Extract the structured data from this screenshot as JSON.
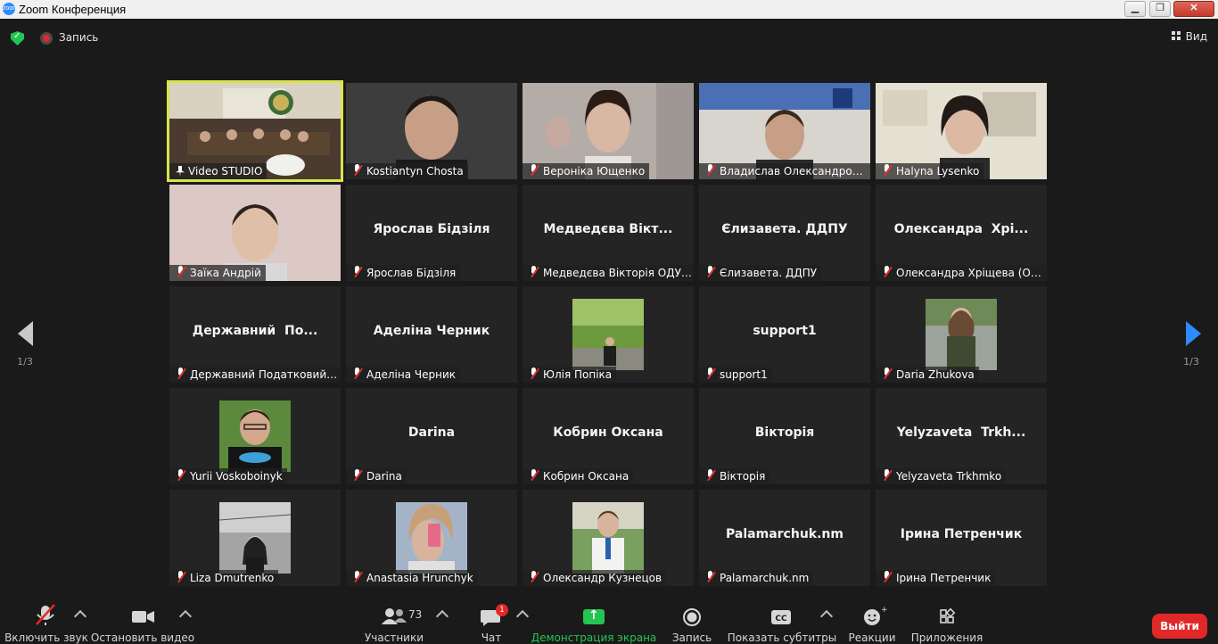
{
  "window": {
    "title": "Zoom Конференция",
    "app_icon": "zoom",
    "buttons": [
      "minimize",
      "maximize",
      "close"
    ]
  },
  "topbar": {
    "recording_label": "Запись",
    "view_label": "Вид"
  },
  "pagination": {
    "left": "1/3",
    "right": "1/3"
  },
  "tiles": [
    {
      "label": "Video STUDIO",
      "display": "",
      "video": "room",
      "icon": "pin-icon",
      "active": true
    },
    {
      "label": "Kostiantyn Chosta",
      "display": "",
      "video": "person-dark",
      "icon": "mute-icon"
    },
    {
      "label": "Вероніка Ющенко",
      "display": "",
      "video": "person-light",
      "icon": "mute-icon"
    },
    {
      "label": "Владислав Олександрови...",
      "display": "",
      "video": "person-blue",
      "icon": "mute-icon"
    },
    {
      "label": "Halyna Lysenko",
      "display": "",
      "video": "person-wall",
      "icon": "mute-icon"
    },
    {
      "label": "Заїка Андрій",
      "display": "",
      "video": "person-pink",
      "icon": "mute-icon"
    },
    {
      "label": "Ярослав Бідзіля",
      "display": "Ярослав Бідзіля",
      "icon": "mute-icon"
    },
    {
      "label": "Медведєва Вікторія ОДУВС",
      "display": "Медведєва Вікт...",
      "icon": "mute-icon"
    },
    {
      "label": "Єлизавета. ДДПУ",
      "display": "Єлизавета. ДДПУ",
      "icon": "mute-icon"
    },
    {
      "label": "Олександра Хріщева (ОНУ)",
      "display": "Олександра  Хрі...",
      "icon": "mute-icon"
    },
    {
      "label": "Державний Податковий у...",
      "display": "Державний  По...",
      "icon": "mute-icon"
    },
    {
      "label": "Аделіна Черник",
      "display": "Аделіна Черник",
      "icon": "mute-icon"
    },
    {
      "label": "Юлія Попіка",
      "display": "",
      "photo": "park",
      "icon": "mute-icon"
    },
    {
      "label": "support1",
      "display": "support1",
      "icon": "mute-icon"
    },
    {
      "label": "Daria Zhukova",
      "display": "",
      "photo": "fountain",
      "icon": "mute-icon"
    },
    {
      "label": "Yurii Voskoboinyk",
      "display": "",
      "photo": "man-tshirt",
      "icon": "mute-icon"
    },
    {
      "label": "Darina",
      "display": "Darina",
      "icon": "mute-icon"
    },
    {
      "label": "Кобрин Оксана",
      "display": "Кобрин Оксана",
      "icon": "mute-icon"
    },
    {
      "label": "Вікторія",
      "display": "Вікторія",
      "icon": "mute-icon"
    },
    {
      "label": "Yelyzaveta Trkhmko",
      "display": "Yelyzaveta  Trkh...",
      "icon": "mute-icon"
    },
    {
      "label": "Liza Dmutrenko",
      "display": "",
      "photo": "bw-rail",
      "icon": "mute-icon"
    },
    {
      "label": "Anastasia Hrunchyk",
      "display": "",
      "photo": "selfie",
      "icon": "mute-icon"
    },
    {
      "label": "Олександр Кузнецов",
      "display": "",
      "photo": "vyshyvanka",
      "icon": "mute-icon"
    },
    {
      "label": "Palamarchuk.nm",
      "display": "Palamarchuk.nm",
      "icon": "mute-icon"
    },
    {
      "label": "Ірина Петренчик",
      "display": "Ірина Петренчик",
      "icon": "mute-icon"
    }
  ],
  "toolbar": {
    "mute": "Включить звук",
    "video": "Остановить видео",
    "participants": "Участники",
    "participants_count": "73",
    "chat": "Чат",
    "chat_badge": "1",
    "share": "Демонстрация экрана",
    "record": "Запись",
    "captions": "Показать субтитры",
    "captions_icon_text": "CC",
    "reactions": "Реакции",
    "apps": "Приложения",
    "exit": "Выйти"
  },
  "colors": {
    "background": "#1a1a1a",
    "tile": "#242424",
    "active_border": "#d8e44a",
    "share_green": "#23c552",
    "exit_red": "#e02828",
    "accent_blue": "#2d8cff"
  }
}
